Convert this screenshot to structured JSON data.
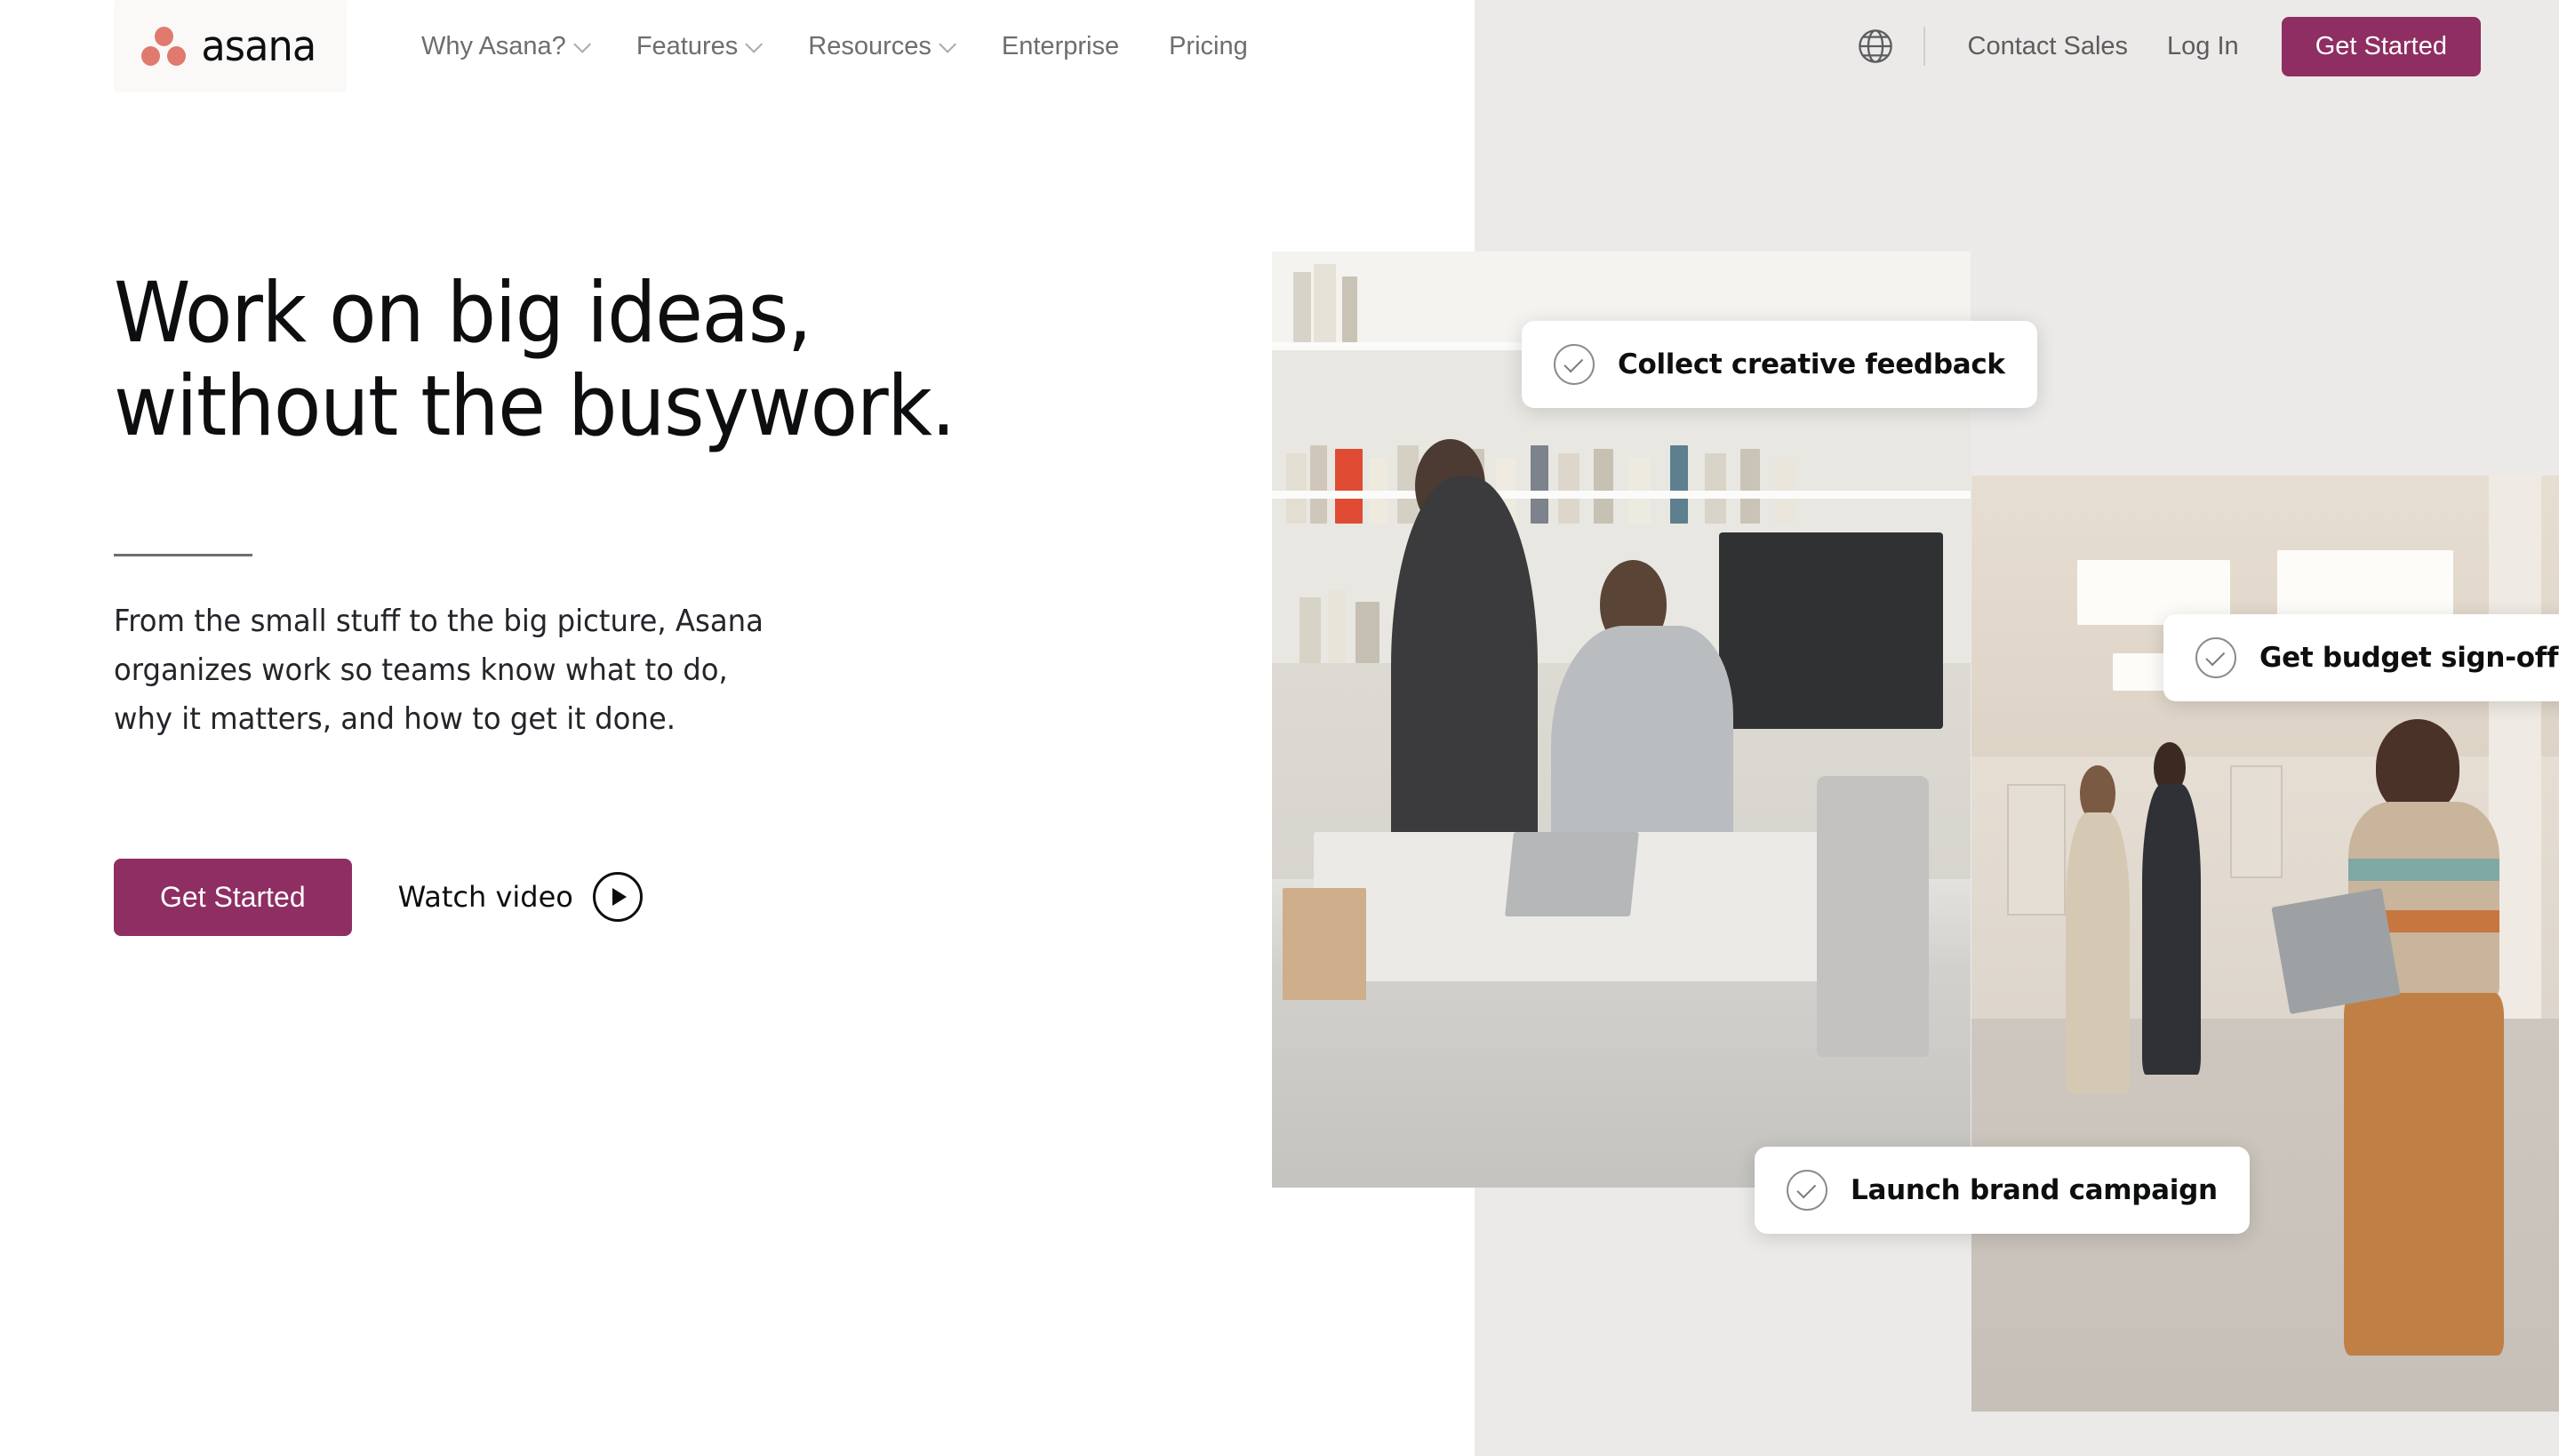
{
  "brand": {
    "logo_text": "asana",
    "logo_icon": "asana-three-dots-logo",
    "dot_color": "#e07a6e"
  },
  "header": {
    "nav_items": [
      {
        "label": "Why Asana?",
        "has_dropdown": true
      },
      {
        "label": "Features",
        "has_dropdown": true
      },
      {
        "label": "Resources",
        "has_dropdown": true
      },
      {
        "label": "Enterprise",
        "has_dropdown": false
      },
      {
        "label": "Pricing",
        "has_dropdown": false
      }
    ],
    "language_icon": "globe-icon",
    "contact_sales": "Contact Sales",
    "log_in": "Log In",
    "get_started": "Get Started"
  },
  "hero": {
    "title_line1": "Work on big ideas,",
    "title_line2": "without the busywork.",
    "subtitle_line1": "From the small stuff to the big picture, Asana",
    "subtitle_line2": "organizes work so teams know what to do,",
    "subtitle_line3": "why it matters, and how to get it done.",
    "primary_cta": "Get Started",
    "secondary_cta": "Watch video",
    "play_icon": "play-circle-icon"
  },
  "task_cards": [
    {
      "label": "Collect creative feedback",
      "icon": "check-circle-icon"
    },
    {
      "label": "Get budget sign-off",
      "icon": "check-circle-icon"
    },
    {
      "label": "Launch brand campaign",
      "icon": "check-circle-icon"
    }
  ],
  "colors": {
    "brand_magenta": "#8e2e62",
    "coral": "#e07a6e",
    "panel_grey": "#ebeae8",
    "text_dark": "#0d0e10",
    "text_muted": "#6d6e6f"
  }
}
